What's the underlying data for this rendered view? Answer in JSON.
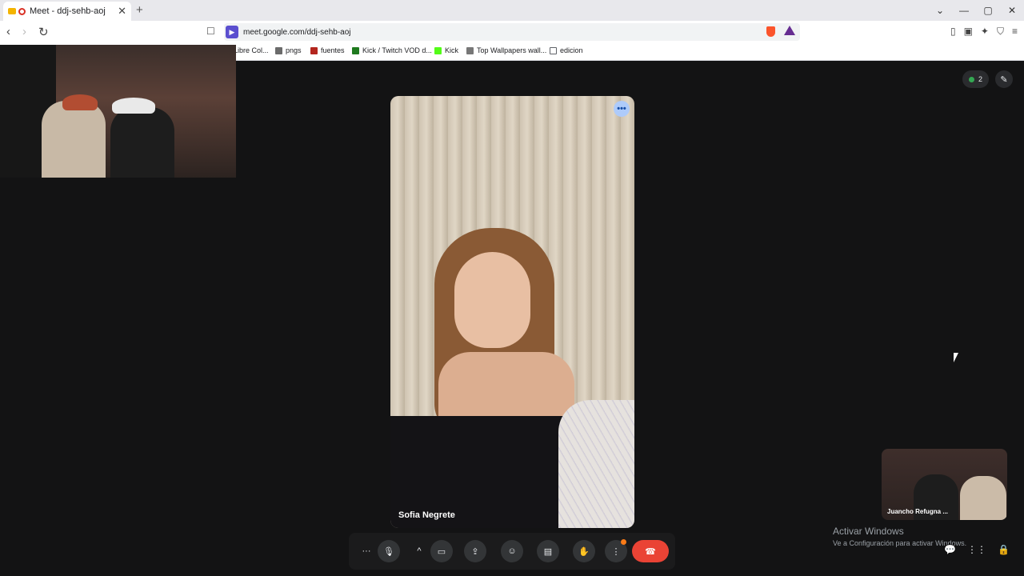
{
  "browser": {
    "tab_title": "Meet - ddj-sehb-aoj",
    "tab_close": "✕",
    "new_tab": "+",
    "url": "meet.google.com/ddj-sehb-aoj",
    "window_controls": [
      "⌄",
      "—",
      "▢",
      "✕"
    ]
  },
  "bookmarks": [
    {
      "label": "Libre Col...",
      "color": "#8a8a8a"
    },
    {
      "label": "pngs",
      "color": "#6b6b6b"
    },
    {
      "label": "fuentes",
      "color": "#b3261e"
    },
    {
      "label": "Kick / Twitch VOD d...",
      "color": "#1f7a1f"
    },
    {
      "label": "Kick",
      "color": "#53fc18"
    },
    {
      "label": "Top Wallpapers wall...",
      "color": "#777777"
    },
    {
      "label": "edicion",
      "color": "#5f6368"
    }
  ],
  "meet": {
    "participant_count": "2",
    "main_participant_name": "Sofia Negrete",
    "self_participant_name": "Juancho Refugna ..."
  },
  "watermark": {
    "title": "Activar Windows",
    "subtitle": "Ve a Configuración para activar Windows."
  },
  "icons": {
    "more_options": "···",
    "mic": "🎙",
    "chevron_up": "^",
    "camera": "▭",
    "present": "⇪",
    "emoji": "☺",
    "captions": "▤",
    "raise_hand": "✋",
    "more_vert": "⋮",
    "end_call": "☎",
    "chat": "💬",
    "activities": "⋮⋮",
    "host_controls": "🔒",
    "tile_menu": "•••",
    "edit": "✎",
    "back": "‹",
    "forward": "›",
    "reload": "↻",
    "bookmark": "☐"
  }
}
